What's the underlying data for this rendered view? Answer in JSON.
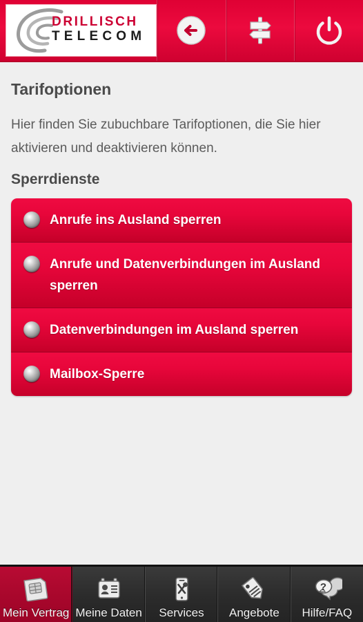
{
  "header": {
    "logo": {
      "line1": "DRILLISCH",
      "line2": "TELECOM",
      "swirl_icon": "swirl-icon",
      "line1_color": "#cc0033",
      "line2_color": "#1a1a1a"
    },
    "buttons": [
      {
        "name": "back-button",
        "icon": "back-arrow-icon",
        "label": ""
      },
      {
        "name": "signpost-button",
        "icon": "signpost-icon",
        "label": ""
      },
      {
        "name": "power-button",
        "icon": "power-icon",
        "label": ""
      }
    ],
    "background_color": "#e8063b"
  },
  "main": {
    "title": "Tarifoptionen",
    "description": "Hier finden Sie zubuchbare Tarifoptionen, die Sie hier aktivieren und deaktivieren können.",
    "section_title": "Sperrdienste",
    "options": [
      {
        "label": "Anrufe ins Ausland sperren",
        "indicator": "toggle-off-icon"
      },
      {
        "label": "Anrufe und Datenverbindungen im Ausland sperren",
        "indicator": "toggle-off-icon"
      },
      {
        "label": "Datenverbindungen im Ausland sperren",
        "indicator": "toggle-off-icon"
      },
      {
        "label": "Mailbox-Sperre",
        "indicator": "toggle-off-icon"
      }
    ],
    "option_color": "#e8063b",
    "text_color": "#4a4a4a"
  },
  "tabbar": {
    "active_index": 0,
    "active_color": "#a8072c",
    "inactive_color": "#2c2c2c",
    "tabs": [
      {
        "label": "Mein Vertrag",
        "icon": "sim-card-icon"
      },
      {
        "label": "Meine Daten",
        "icon": "id-card-icon"
      },
      {
        "label": "Services",
        "icon": "phone-tools-icon"
      },
      {
        "label": "Angebote",
        "icon": "price-tag-icon"
      },
      {
        "label": "Hilfe/FAQ",
        "icon": "speech-bubbles-question-icon"
      }
    ]
  }
}
